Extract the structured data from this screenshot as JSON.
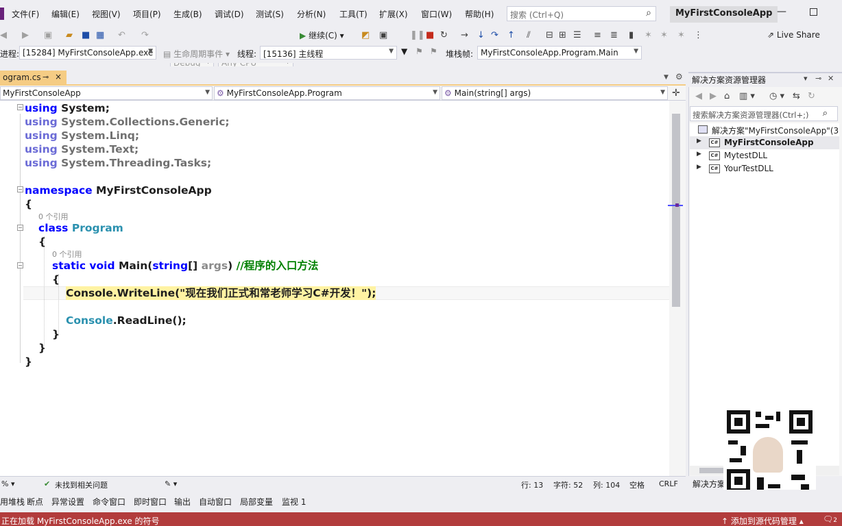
{
  "menu": {
    "items": [
      "文件(F)",
      "编辑(E)",
      "视图(V)",
      "项目(P)",
      "生成(B)",
      "调试(D)",
      "测试(S)",
      "分析(N)",
      "工具(T)",
      "扩展(X)",
      "窗口(W)",
      "帮助(H)"
    ],
    "search_placeholder": "搜索 (Ctrl+Q)",
    "solution_title": "MyFirstConsoleApp"
  },
  "toolbar": {
    "config": "Debug",
    "platform": "Any CPU",
    "continue": "继续(C)",
    "live_share": "Live Share",
    "process_label": "进程:",
    "process_value": "[15284] MyFirstConsoleApp.exe",
    "lifecycle": "生命周期事件",
    "thread_label": "线程:",
    "thread_value": "[15136] 主线程",
    "stackframe_label": "堆栈帧:",
    "stackframe_value": "MyFirstConsoleApp.Program.Main"
  },
  "editor": {
    "tab_name": "ogram.cs",
    "nav_project": "MyFirstConsoleApp",
    "nav_class": "MyFirstConsoleApp.Program",
    "nav_member": "Main(string[] args)",
    "codelens_refs": "0 个引用",
    "code": {
      "using_kw": "using",
      "using1": "System;",
      "using2": "System.Collections.Generic;",
      "using3": "System.Linq;",
      "using4": "System.Text;",
      "using5": "System.Threading.Tasks;",
      "namespace_kw": "namespace",
      "namespace_name": "MyFirstConsoleApp",
      "open_brace": "{",
      "close_brace": "}",
      "class_kw": "class",
      "class_name": "Program",
      "static_kw": "static",
      "void_kw": "void",
      "main_name": "Main(",
      "string_kw": "string",
      "brackets": "[]",
      "args": "args",
      "close_paren": ")",
      "main_comment": "//程序的入口方法",
      "writeline_stmt": "Console.WriteLine(\"现在我们正式和常老师学习C#开发！\");",
      "console_type": "Console",
      "readline_rest": ".ReadLine();"
    },
    "status": {
      "zoom": "%",
      "issues": "未找到相关问题",
      "line": "行: 13",
      "char": "字符: 52",
      "col": "列: 104",
      "space": "空格",
      "eol": "CRLF"
    }
  },
  "solution_explorer": {
    "title": "解决方案资源管理器",
    "search_placeholder": "搜索解决方案资源管理器(Ctrl+;)",
    "solution_node": "解决方案\"MyFirstConsoleApp\"(3",
    "projects": [
      "MyFirstConsoleApp",
      "MytestDLL",
      "YourTestDLL"
    ],
    "bottom_tab": "解决方案资源管理器"
  },
  "bottom_tabs": [
    "用堆栈",
    "断点",
    "异常设置",
    "命令窗口",
    "即时窗口",
    "输出",
    "自动窗口",
    "局部变量",
    "监视 1"
  ],
  "statusbar": {
    "message": "正在加载 MyFirstConsoleApp.exe 的符号",
    "source_control": "添加到源代码管理",
    "notifications": "2"
  }
}
